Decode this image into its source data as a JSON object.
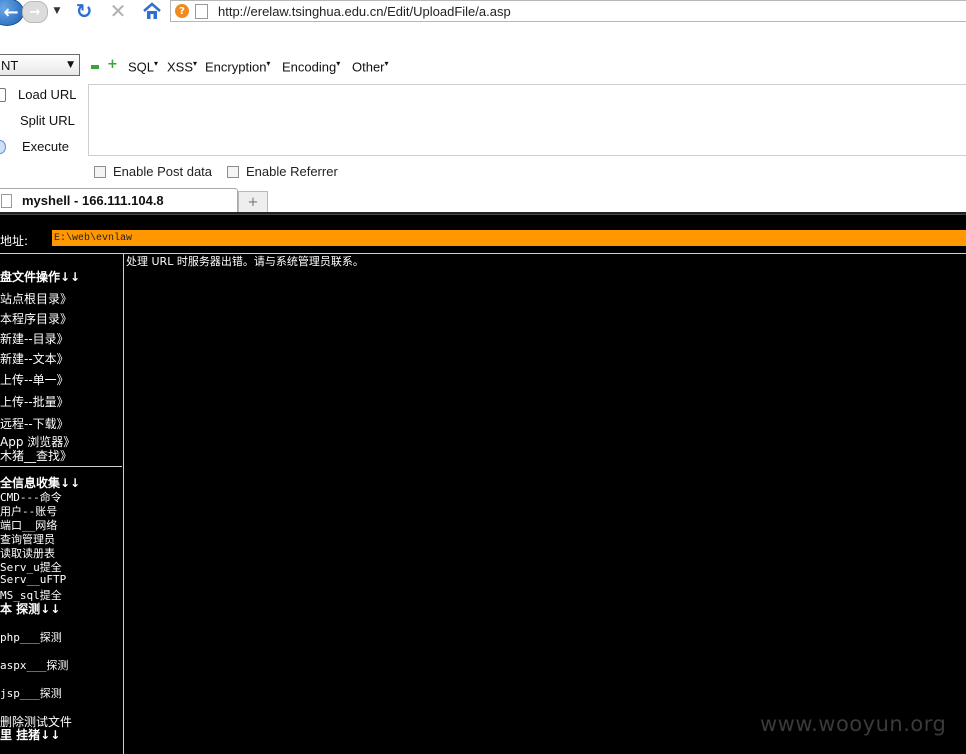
{
  "browser": {
    "url": "http://erelaw.tsinghua.edu.cn/Edit/UploadFile/a.asp",
    "site_badge": "?"
  },
  "hackbar": {
    "select_value": "NT",
    "menus": [
      "SQL",
      "XSS",
      "Encryption",
      "Encoding",
      "Other"
    ],
    "actions": [
      "Load URL",
      "Split URL",
      "Execute"
    ],
    "checkbox_post": "Enable Post data",
    "checkbox_referrer": "Enable Referrer",
    "accent": "#3aa33a"
  },
  "tab": {
    "title": "myshell - 166.111.104.8",
    "new_tab": "+"
  },
  "shell": {
    "address_label": "地址:",
    "address_value": "E:\\web\\evnlaw",
    "address_color": "#ff9800",
    "error_message": "处理 URL 时服务器出错。请与系统管理员联系。",
    "sections": [
      {
        "header": "盘文件操作↓↓",
        "items": [
          "站点根目录》",
          "本程序目录》",
          "新建--目录》",
          "新建--文本》",
          "上传--单一》",
          "上传--批量》",
          "远程--下载》",
          "App 浏览器》",
          "木猪__查找》"
        ]
      },
      {
        "header": "全信息收集↓↓",
        "items": [
          "CMD---命令",
          "用户--账号",
          "端口__网络",
          "查询管理员",
          "读取读册表",
          "Serv_u提全",
          "Serv__uFTP",
          "MS_sql提全"
        ]
      },
      {
        "header": "本 探测↓↓",
        "items": [
          "php___探测",
          "aspx___探测",
          "jsp___探测",
          "删除测试文件"
        ]
      },
      {
        "header": "里 挂猪↓↓",
        "items": []
      }
    ]
  },
  "watermark": "www.wooyun.org"
}
